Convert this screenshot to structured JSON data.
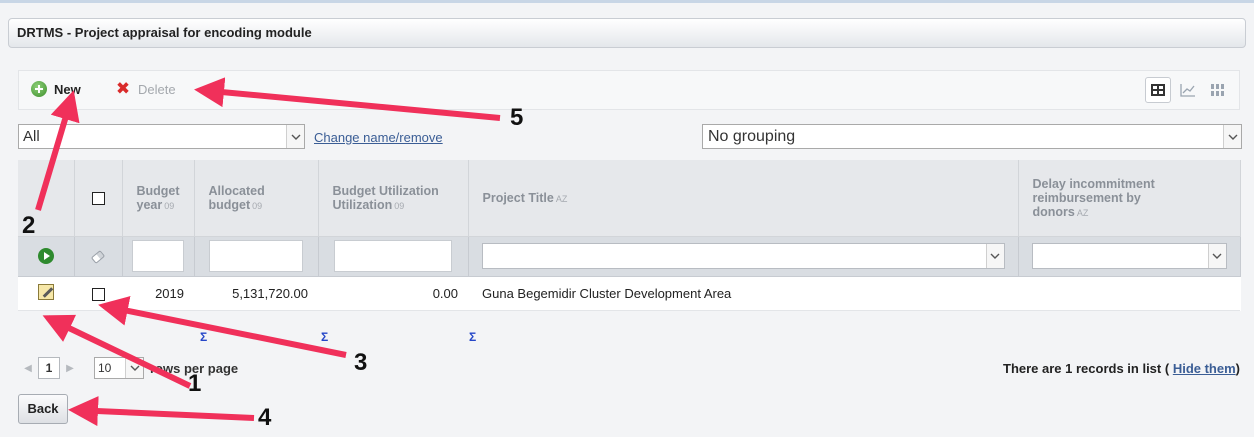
{
  "panel": {
    "title": "DRTMS - Project appraisal for encoding module"
  },
  "toolbar": {
    "new_label": "New",
    "delete_label": "Delete",
    "view_icons": [
      "grid-view-icon",
      "chart-view-icon",
      "tile-view-icon"
    ]
  },
  "filter": {
    "selected": "All",
    "change_link": "Change name/remove"
  },
  "grouping": {
    "selected": "No grouping"
  },
  "table": {
    "columns": [
      {
        "line1": "Budget",
        "line2": "year"
      },
      {
        "line1": "Allocated",
        "line2": "budget"
      },
      {
        "line1": "Budget Utilization",
        "line2": "Utilization"
      },
      {
        "line1": "Project Title",
        "line2": ""
      },
      {
        "line1": "Delay incommitment",
        "line2": "reimbursement by",
        "line3": "donors"
      }
    ],
    "sort_num_glyph": "09",
    "sort_alpha_glyph": "AZ",
    "rows": [
      {
        "budget_year": "2019",
        "allocated_budget": "5,131,720.00",
        "utilization": "0.00",
        "project_title": "Guna Begemidir Cluster Development Area",
        "delay": ""
      }
    ],
    "sum_symbol": "Σ"
  },
  "pager": {
    "current_page": "1",
    "rows_per_page": "10",
    "rows_per_page_label": "rows per page",
    "records_text": "There are 1 records in list (",
    "hide_link": "Hide them",
    "records_close": ")"
  },
  "back_label": "Back",
  "annotations": [
    "1",
    "2",
    "3",
    "4",
    "5"
  ],
  "colors": {
    "arrow": "#f0305a",
    "accent_link": "#3a5d95",
    "sum": "#2546c8"
  }
}
